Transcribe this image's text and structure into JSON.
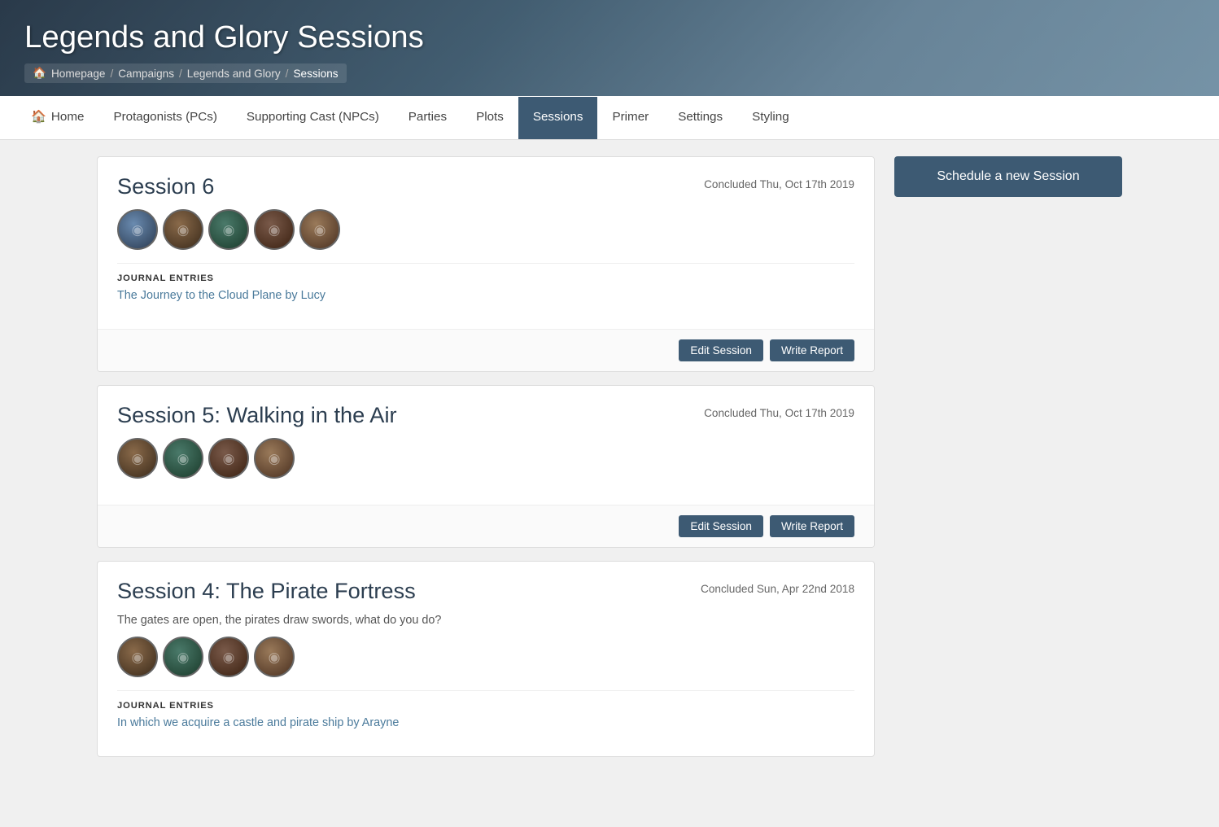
{
  "header": {
    "title": "Legends and Glory Sessions",
    "breadcrumb": [
      {
        "label": "Homepage",
        "icon": "home"
      },
      {
        "label": "Campaigns"
      },
      {
        "label": "Legends and Glory"
      },
      {
        "label": "Sessions",
        "current": true
      }
    ]
  },
  "nav": {
    "items": [
      {
        "label": "Home",
        "icon": "home",
        "active": false
      },
      {
        "label": "Protagonists (PCs)",
        "active": false
      },
      {
        "label": "Supporting Cast (NPCs)",
        "active": false
      },
      {
        "label": "Parties",
        "active": false
      },
      {
        "label": "Plots",
        "active": false
      },
      {
        "label": "Sessions",
        "active": true
      },
      {
        "label": "Primer",
        "active": false
      },
      {
        "label": "Settings",
        "active": false
      },
      {
        "label": "Styling",
        "active": false
      }
    ]
  },
  "sessions": [
    {
      "title": "Session 6",
      "date": "Concluded Thu, Oct 17th 2019",
      "description": "",
      "avatars": 5,
      "journal_label": "JOURNAL ENTRIES",
      "journal_link": "The Journey to the Cloud Plane by Lucy",
      "edit_label": "Edit Session",
      "report_label": "Write Report"
    },
    {
      "title": "Session 5: Walking in the Air",
      "date": "Concluded Thu, Oct 17th 2019",
      "description": "",
      "avatars": 4,
      "journal_label": "",
      "journal_link": "",
      "edit_label": "Edit Session",
      "report_label": "Write Report"
    },
    {
      "title": "Session 4: The Pirate Fortress",
      "date": "Concluded Sun, Apr 22nd 2018",
      "description": "The gates are open, the pirates draw swords, what do you do?",
      "avatars": 4,
      "journal_label": "JOURNAL ENTRIES",
      "journal_link": "In which we acquire a castle and pirate ship by Arayne",
      "edit_label": "Edit Session",
      "report_label": "Write Report"
    }
  ],
  "sidebar": {
    "schedule_label": "Schedule a new Session"
  }
}
